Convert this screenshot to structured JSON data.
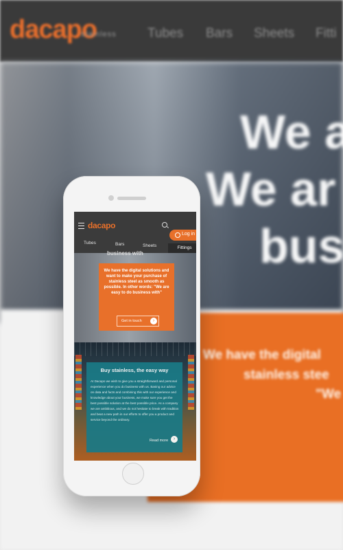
{
  "background": {
    "logo": "dacapo",
    "tagline": "stainless",
    "nav": [
      "Tubes",
      "Bars",
      "Sheets",
      "Fitti"
    ],
    "hero_lines": [
      "We a",
      "We ar",
      "bus"
    ],
    "orange_lines": [
      "We have the digital",
      "stainless stee",
      "\"We"
    ]
  },
  "mobile": {
    "header": {
      "logo": "dacapo",
      "login_label": "Log in",
      "nav": [
        "Tubes",
        "Bars",
        "Sheets",
        "Fittings"
      ]
    },
    "hero": {
      "partial_title": "business with",
      "card_text": "We have the digital solutions and want to make your purchase of stainless steel as smooth as possible. In other words: \"We are easy to do business with\"",
      "cta_label": "Get in touch"
    },
    "section": {
      "title": "Buy stainless, the easy way",
      "body": "At Dacapo we wish to give you a straightforward and personal experience when you do business with us. Basing our advice on data and facts and combining this with our experience and knowledge about your business, we make sure you get the best possible solution at the best possible price. As a company we are ambitious, and we do not hesitate to break with tradition and beat a new path in our efforts to offer you a product and service beyond the ordinary.",
      "read_more": "Read more"
    }
  },
  "colors": {
    "brand_orange": "#e8702a",
    "dark_header": "#3b3b3b",
    "teal": "#1a7a86"
  }
}
